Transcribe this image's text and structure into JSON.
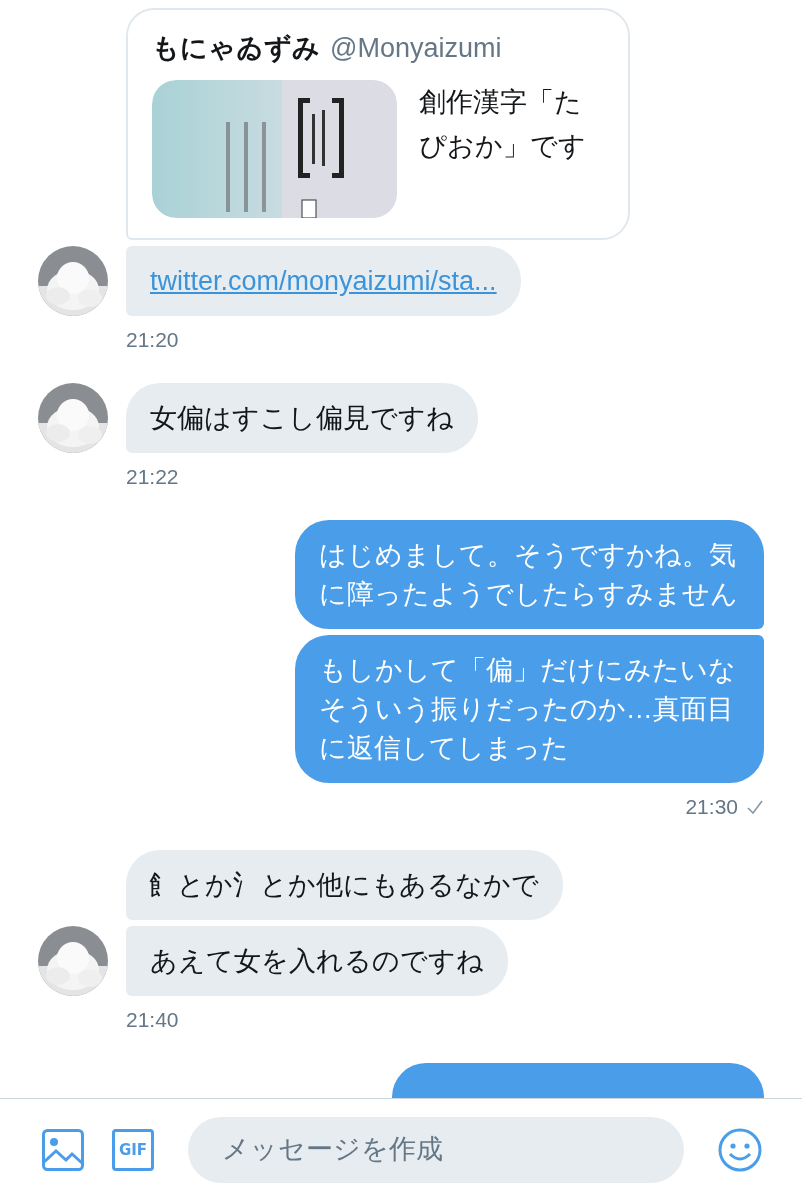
{
  "conversation": [
    {
      "kind": "incoming",
      "avatar": true,
      "time": "21:20",
      "bubbles": [
        {
          "kind": "card",
          "author": "もにゃゐずみ",
          "handle": "@Monyaizumi",
          "text": "創作漢字「たぴおか」です"
        },
        {
          "kind": "link",
          "text": "twitter.com/monyaizumi/sta..."
        }
      ]
    },
    {
      "kind": "incoming",
      "avatar": true,
      "time": "21:22",
      "bubbles": [
        {
          "kind": "text",
          "text": "女偏はすこし偏見ですね"
        }
      ]
    },
    {
      "kind": "outgoing",
      "time": "21:30",
      "read": true,
      "bubbles": [
        {
          "kind": "text",
          "text": "はじめまして。そうですかね。気に障ったようでしたらすみません"
        },
        {
          "kind": "text",
          "text": "もしかして「偏」だけにみたいなそういう振りだったのか…真面目に返信してしまった"
        }
      ]
    },
    {
      "kind": "incoming",
      "avatar": true,
      "time": "21:40",
      "bubbles": [
        {
          "kind": "text",
          "text": "飠とか氵とか他にもあるなかで"
        },
        {
          "kind": "text",
          "text": "あえて女を入れるのですね"
        }
      ]
    },
    {
      "kind": "outgoing",
      "bubbles": [
        {
          "kind": "partial"
        }
      ]
    }
  ],
  "composer": {
    "gif_label": "GIF",
    "placeholder": "メッセージを作成"
  }
}
